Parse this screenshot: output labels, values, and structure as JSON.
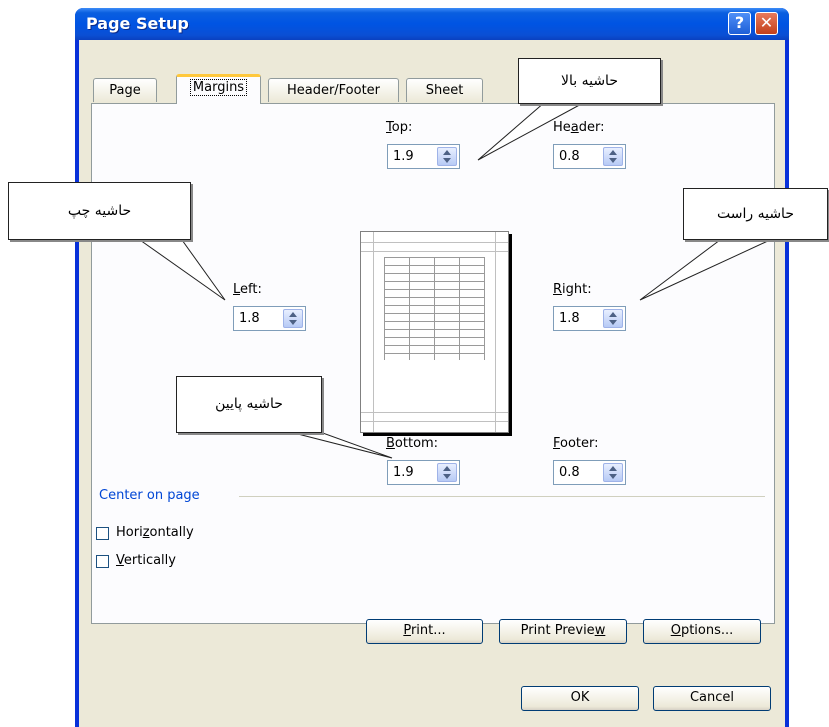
{
  "window": {
    "title": "Page Setup",
    "help_glyph": "?",
    "close_glyph": "✕"
  },
  "tabs": [
    "Page",
    "Margins",
    "Header/Footer",
    "Sheet"
  ],
  "fields": {
    "top": {
      "label": "Top:",
      "value": "1.9"
    },
    "header": {
      "label": "Header:",
      "value": "0.8"
    },
    "left": {
      "label": "Left:",
      "value": "1.8"
    },
    "right": {
      "label": "Right:",
      "value": "1.8"
    },
    "bottom": {
      "label": "Bottom:",
      "value": "1.9"
    },
    "footer": {
      "label": "Footer:",
      "value": "0.8"
    }
  },
  "callouts": {
    "top": "حاشیه بالا",
    "left": "حاشیه چپ",
    "right": "حاشیه راست",
    "bottom": "حاشیه پایین"
  },
  "center": {
    "group_label": "Center on page",
    "horizontally": "Horizontally",
    "vertically": "Vertically"
  },
  "buttons": {
    "print": "Print...",
    "print_preview": "Print Preview",
    "options": "Options...",
    "ok": "OK",
    "cancel": "Cancel"
  },
  "colors": {
    "title_bar": "#0054e3",
    "dialog_bg": "#ece9d8",
    "active_tab_accent": "#ffc83c"
  }
}
